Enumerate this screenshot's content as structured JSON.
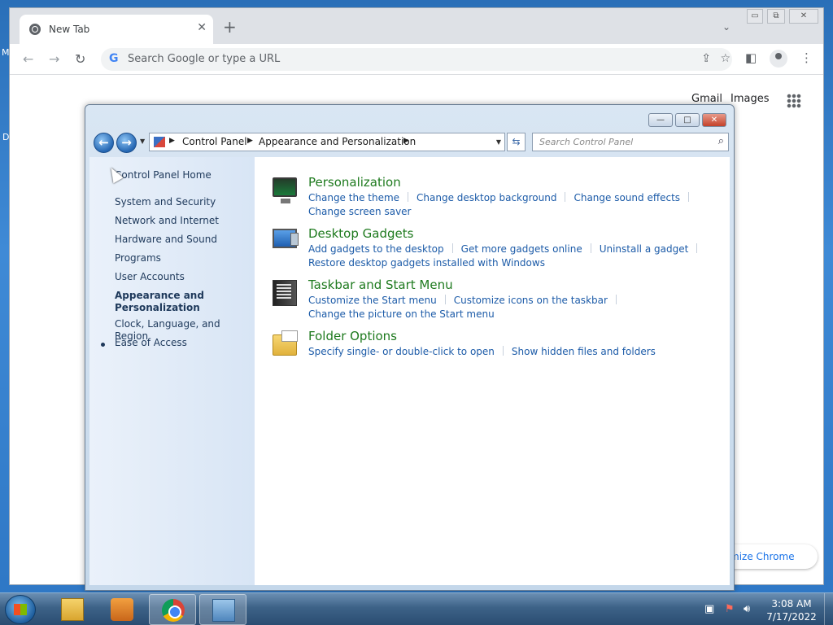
{
  "desktop": {
    "side_letters": [
      "M",
      "D"
    ]
  },
  "chrome": {
    "tab_title": "New Tab",
    "tab_close": "✕",
    "new_tab": "+",
    "omnibox_placeholder": "Search Google or type a URL",
    "links": {
      "gmail": "Gmail",
      "images": "Images"
    },
    "customize_label": "mize Chrome",
    "window_controls": {
      "minimize": "▭",
      "restore": "⧉",
      "close": "✕"
    }
  },
  "control_panel": {
    "window_controls": {
      "minimize": "—",
      "maximize": "□",
      "close": "✕"
    },
    "breadcrumb": [
      "Control Panel",
      "Appearance and Personalization"
    ],
    "search_placeholder": "Search Control Panel",
    "nav": {
      "home": "Control Panel Home",
      "items": [
        "System and Security",
        "Network and Internet",
        "Hardware and Sound",
        "Programs",
        "User Accounts",
        "Appearance and Personalization",
        "Clock, Language, and Region",
        "Ease of Access"
      ],
      "current_index": 5
    },
    "categories": [
      {
        "title": "Personalization",
        "icon": "monitor-icon",
        "links": [
          "Change the theme",
          "Change desktop background",
          "Change sound effects"
        ],
        "links2": [
          "Change screen saver"
        ]
      },
      {
        "title": "Desktop Gadgets",
        "icon": "gadget-icon",
        "links": [
          "Add gadgets to the desktop",
          "Get more gadgets online",
          "Uninstall a gadget"
        ],
        "links2": [
          "Restore desktop gadgets installed with Windows"
        ]
      },
      {
        "title": "Taskbar and Start Menu",
        "icon": "taskbar-icon",
        "links": [
          "Customize the Start menu",
          "Customize icons on the taskbar"
        ],
        "links2": [
          "Change the picture on the Start menu"
        ]
      },
      {
        "title": "Folder Options",
        "icon": "folder-options-icon",
        "links": [
          "Specify single- or double-click to open",
          "Show hidden files and folders"
        ],
        "links2": []
      }
    ]
  },
  "taskbar": {
    "clock_time": "3:08 AM",
    "clock_date": "7/17/2022",
    "pinned": [
      "explorer-icon",
      "media-player-icon",
      "chrome-icon",
      "control-panel-icon"
    ]
  }
}
